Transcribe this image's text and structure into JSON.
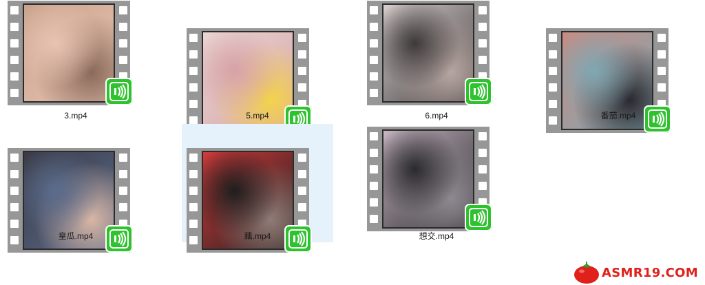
{
  "colors": {
    "film_strip": "#979797",
    "badge": "#2fc22f",
    "selection": "#e5f1fb",
    "watermark": "#e0201b"
  },
  "files": [
    {
      "name": "3.mp4",
      "thumb_colors": [
        "#c9a38b",
        "#e8c3b3",
        "#8a6a5a"
      ],
      "selected": false,
      "icon": "video-badge-icon"
    },
    {
      "name": "5.mp4",
      "thumb_colors": [
        "#e9d6d2",
        "#d7a2a8",
        "#f4d34a"
      ],
      "selected": false,
      "icon": "video-badge-icon"
    },
    {
      "name": "6.mp4",
      "thumb_colors": [
        "#d9cfcf",
        "#3e3a3a",
        "#b7a6a1"
      ],
      "selected": false,
      "icon": "video-badge-icon"
    },
    {
      "name": "番茄.mp4",
      "thumb_colors": [
        "#c98b82",
        "#7fa8b3",
        "#2a2a30"
      ],
      "selected": false,
      "icon": "video-badge-icon"
    },
    {
      "name": "皇瓜.mp4",
      "thumb_colors": [
        "#3a3a44",
        "#5a6b8c",
        "#d9b7a6"
      ],
      "selected": false,
      "icon": "video-badge-icon"
    },
    {
      "name": "藕.mp4",
      "thumb_colors": [
        "#d23a3a",
        "#1e1e1e",
        "#8f7c77"
      ],
      "selected": true,
      "icon": "video-badge-icon"
    },
    {
      "name": "想交.mp4",
      "thumb_colors": [
        "#c8b6c2",
        "#2a2a2e",
        "#8f8890"
      ],
      "selected": false,
      "icon": "video-badge-icon"
    }
  ],
  "watermark": {
    "text": "ASMR19.COM",
    "icon": "tomato-icon"
  }
}
